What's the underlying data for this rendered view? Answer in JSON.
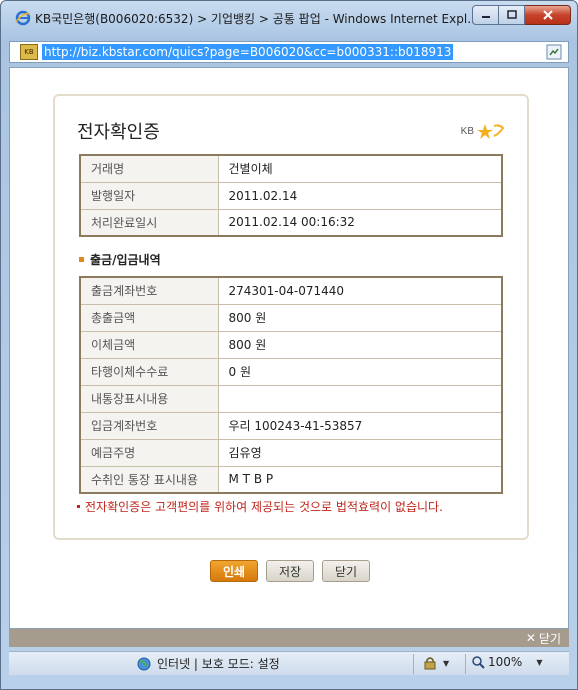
{
  "window": {
    "title": "KB국민은행(B006020:6532) > 기업뱅킹 > 공통 팝업 - Windows Internet Expl...",
    "url": "http://biz.kbstar.com/quics?page=B006020&cc=b000331::b018913"
  },
  "certificate": {
    "title": "전자확인증",
    "logo_text": "KB",
    "summary_rows": [
      {
        "label": "거래명",
        "value": "건별이체"
      },
      {
        "label": "발행일자",
        "value": "2011.02.14"
      },
      {
        "label": "처리완료일시",
        "value": "2011.02.14 00:16:32"
      }
    ],
    "section_title": "출금/입금내역",
    "detail_rows": [
      {
        "label": "출금계좌번호",
        "value": "274301-04-071440"
      },
      {
        "label": "총출금액",
        "value": "800 원"
      },
      {
        "label": "이체금액",
        "value": "800 원"
      },
      {
        "label": "타행이체수수료",
        "value": "0 원"
      },
      {
        "label": "내통장표시내용",
        "value": ""
      },
      {
        "label": "입금계좌번호",
        "value": "우리 100243-41-53857"
      },
      {
        "label": "예금주명",
        "value": "김유영"
      },
      {
        "label": "수취인 통장 표시내용",
        "value": "M T B P"
      }
    ],
    "notice": "전자확인증은 고객편의를 위하여 제공되는 것으로 법적효력이 없습니다."
  },
  "buttons": {
    "print": "인쇄",
    "save": "저장",
    "close": "닫기"
  },
  "closebar": {
    "label": "닫기"
  },
  "statusbar": {
    "zone": "인터넷 | 보호 모드: 설정",
    "zoom": "100%"
  },
  "colors": {
    "accent": "#d5790b",
    "notice": "#c0261c",
    "table_border": "#8c7a5e"
  }
}
